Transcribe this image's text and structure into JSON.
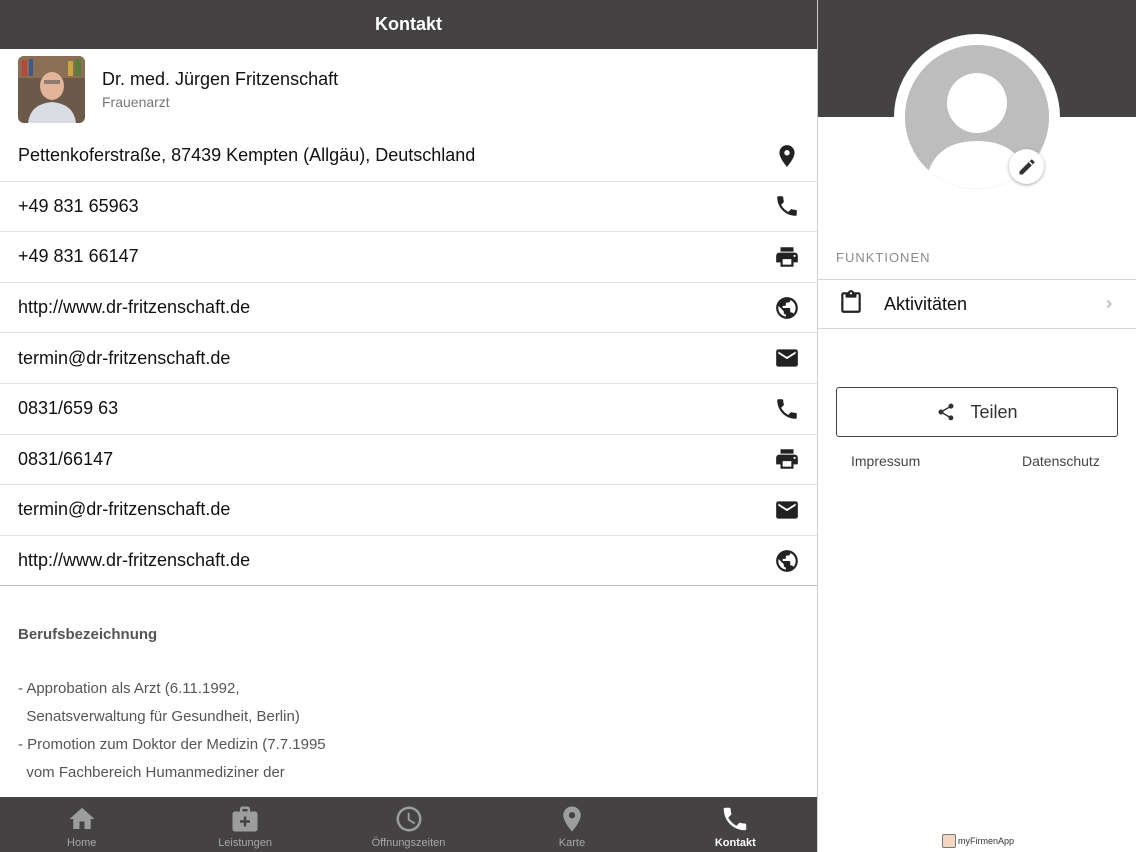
{
  "header": {
    "title": "Kontakt"
  },
  "profile": {
    "name": "Dr. med. Jürgen Fritzenschaft",
    "subtitle": "Frauenarzt"
  },
  "contacts": [
    {
      "text": "Pettenkoferstraße, 87439 Kempten (Allgäu), Deutschland",
      "icon": "location-pin-icon"
    },
    {
      "text": "+49 831 65963",
      "icon": "phone-icon"
    },
    {
      "text": "+49 831 66147",
      "icon": "printer-icon"
    },
    {
      "text": "http://www.dr-fritzenschaft.de",
      "icon": "globe-icon"
    },
    {
      "text": "termin@dr-fritzenschaft.de",
      "icon": "mail-icon"
    },
    {
      "text": "0831/659 63",
      "icon": "phone-icon"
    },
    {
      "text": "0831/66147",
      "icon": "printer-icon"
    },
    {
      "text": "termin@dr-fritzenschaft.de",
      "icon": "mail-icon"
    },
    {
      "text": "http://www.dr-fritzenschaft.de",
      "icon": "globe-icon"
    }
  ],
  "description": {
    "title": "Berufsbezeichnung",
    "lines": [
      "- Approbation als Arzt (6.11.1992,",
      "  Senatsverwaltung für Gesundheit, Berlin)",
      "- Promotion zum Doktor der Medizin (7.7.1995",
      "  vom Fachbereich Humanmediziner der"
    ]
  },
  "tabs": [
    {
      "label": "Home",
      "icon": "home-icon",
      "active": false
    },
    {
      "label": "Leistungen",
      "icon": "medical-bag-icon",
      "active": false
    },
    {
      "label": "Öffnungszeiten",
      "icon": "clock-icon",
      "active": false
    },
    {
      "label": "Karte",
      "icon": "location-pin-icon",
      "active": false
    },
    {
      "label": "Kontakt",
      "icon": "phone-icon",
      "active": true
    }
  ],
  "sidebar": {
    "section_label": "FUNKTIONEN",
    "function_item": "Aktivitäten",
    "share_label": "Teilen",
    "impressum": "Impressum",
    "datenschutz": "Datenschutz",
    "footer_logo": "myFirmenApp"
  },
  "colors": {
    "bar": "#444243",
    "active_tab": "#ffffff",
    "inactive_tab": "#9d9d9d"
  }
}
